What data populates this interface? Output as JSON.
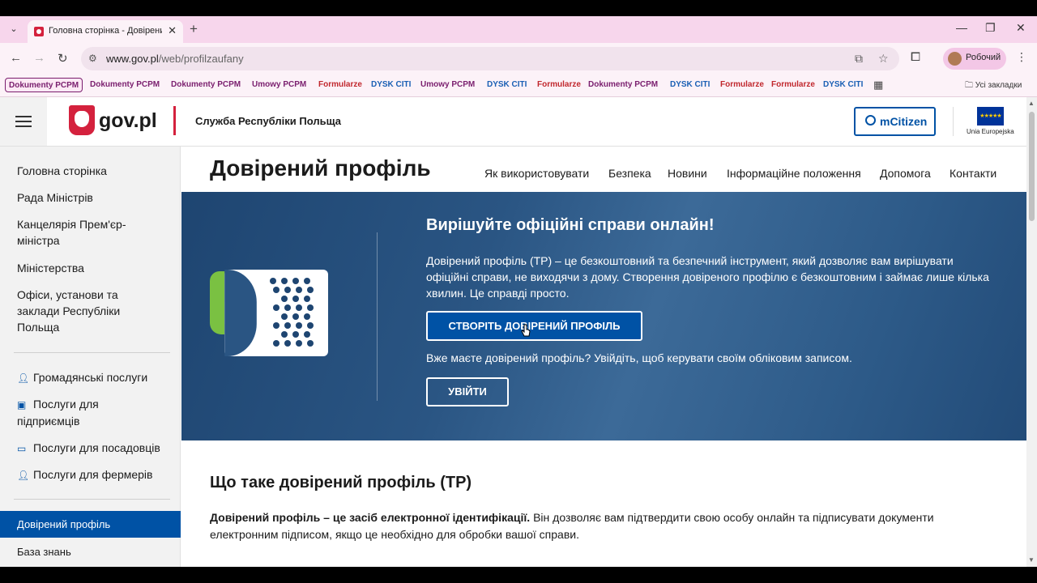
{
  "browser": {
    "tab_title": "Головна сторінка - Довірений",
    "url_host": "www.gov.pl",
    "url_path": "/web/profilzaufany",
    "profile_name": "Робочий",
    "all_bookmarks": "Усі закладки",
    "bookmarks": [
      {
        "label": "Dokumenty PCPM",
        "color": "#7a1e6e"
      },
      {
        "label": "Dokumenty PCPM",
        "color": "#7a1e6e"
      },
      {
        "label": "Dokumenty PCPM",
        "color": "#7a1e6e"
      },
      {
        "label": "Umowy PCPM",
        "color": "#7a1e6e"
      },
      {
        "label": "Formularze",
        "color": "#c1272d"
      },
      {
        "label": "DYSK CITI",
        "color": "#1a5fb4"
      },
      {
        "label": "Umowy PCPM",
        "color": "#7a1e6e"
      },
      {
        "label": "DYSK CITI",
        "color": "#1a5fb4"
      },
      {
        "label": "Formularze",
        "color": "#c1272d"
      },
      {
        "label": "Dokumenty PCPM",
        "color": "#7a1e6e"
      },
      {
        "label": "DYSK CITI",
        "color": "#1a5fb4"
      },
      {
        "label": "Formularze",
        "color": "#c1272d"
      },
      {
        "label": "Formularze",
        "color": "#c1272d"
      },
      {
        "label": "DYSK CITI",
        "color": "#1a5fb4"
      }
    ]
  },
  "header": {
    "logo": "gov.pl",
    "service": "Служба Республіки Польща",
    "mcitizen": "mCitizen",
    "eu_label": "Unia Europejska"
  },
  "sidebar": {
    "primary": [
      "Головна сторінка",
      "Рада Міністрів",
      "Канцелярія Прем'єр-міністра",
      "Міністерства",
      "Офіси, установи та заклади Республіки Польща"
    ],
    "services": [
      "Громадянські послуги",
      "Послуги для підприємців",
      "Послуги для посадовців",
      "Послуги для фермерів"
    ],
    "active": "Довірений профіль",
    "next": "База знань"
  },
  "main": {
    "title": "Довірений профіль",
    "nav": [
      "Як використовувати",
      "Безпека",
      "Новини",
      "Інформаційне положення",
      "Допомога",
      "Контакти"
    ],
    "hero_heading": "Вирішуйте офіційні справи онлайн!",
    "hero_text": "Довірений профіль (ТР) – це безкоштовний та безпечний інструмент, який дозволяє вам вирішувати офіційні справи, не виходячи з дому. Створення довіреного профілю є безкоштовним і займає лише кілька хвилин. Це справді просто.",
    "create_button": "СТВОРІТЬ ДОВІРЕНИЙ ПРОФІЛЬ",
    "login_question": "Вже маєте довірений профіль? Увійдіть, щоб керувати своїм обліковим записом.",
    "login_button": "УВІЙТИ",
    "section_heading": "Що таке довірений профіль (ТР)",
    "section_bold": "Довірений профіль – це засіб електронної ідентифікації.",
    "section_text": " Він дозволяє вам підтвердити свою особу онлайн та підписувати документи електронним підписом, якщо це необхідно для обробки вашої справи."
  }
}
